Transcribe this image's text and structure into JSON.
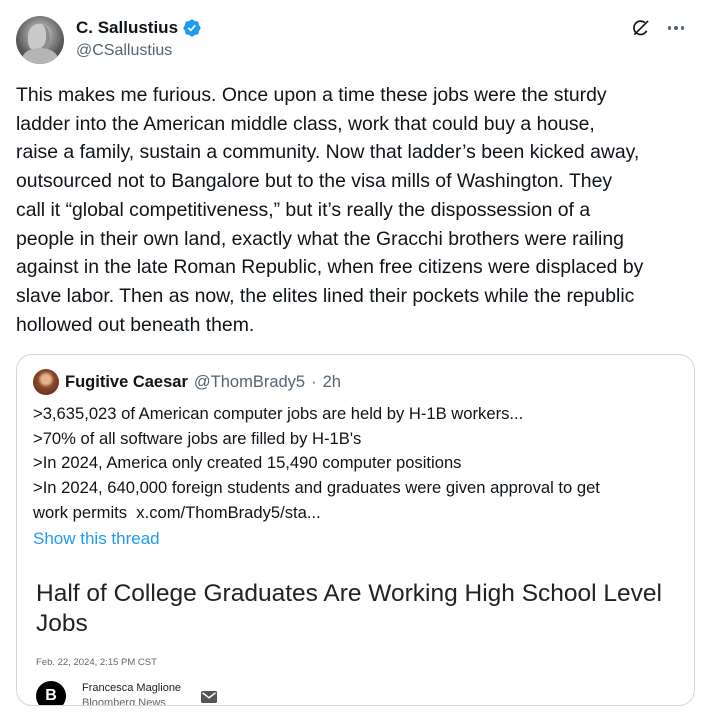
{
  "author": {
    "display_name": "C. Sallustius",
    "handle": "@CSallustius",
    "verified": true
  },
  "tweet": {
    "text": "This makes me furious. Once upon a time these jobs were the sturdy\nladder into the American middle class, work that could buy a house,\nraise a family, sustain a community. Now that ladder’s been kicked away,\noutsourced not to Bangalore but to the visa mills of Washington. They\ncall it “global competitiveness,” but it’s really the dispossession of a\npeople in their own land, exactly what the Gracchi brothers were railing\nagainst in the late Roman Republic, when free citizens were displaced by\nslave labor. Then as now, the elites lined their pockets while the republic\nhollowed out beneath them."
  },
  "quote": {
    "display_name": "Fugitive Caesar",
    "handle": "@ThomBrady5",
    "separator": "·",
    "time": "2h",
    "lines": [
      ">3,635,023 of American computer jobs are held by H-1B workers...",
      ">70% of all software jobs are filled by H-1B's",
      ">In 2024, America only created 15,490 computer positions",
      ">In 2024, 640,000 foreign students and graduates were given approval to get"
    ],
    "last_line_prefix": "work permits",
    "link_text": "x.com/ThomBrady5/sta...",
    "show_thread": "Show this thread",
    "article": {
      "title": "Half of College Graduates Are Working High School Level Jobs",
      "date": "Feb. 22, 2024, 2:15 PM CST",
      "logo_letter": "B",
      "author_name": "Francesca Maglione",
      "author_org": "Bloomberg News"
    }
  },
  "colors": {
    "text": "#0f1419",
    "secondary": "#536471",
    "accent": "#1d9bf0",
    "border": "#cfd9de"
  },
  "icons": [
    "verified-badge-icon",
    "grok-icon",
    "more-icon",
    "mail-icon"
  ]
}
